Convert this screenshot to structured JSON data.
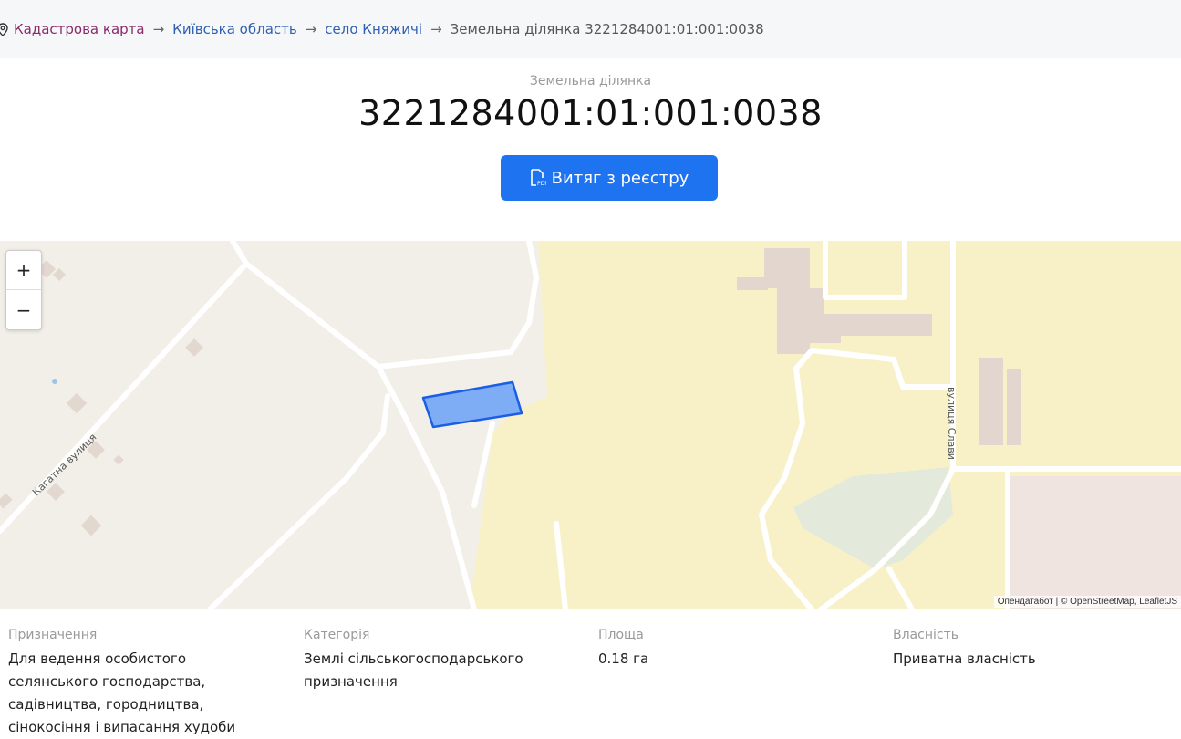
{
  "breadcrumb": {
    "root": "Кадастрова карта",
    "separator": "→",
    "items": [
      "Київська область",
      "село Княжичі"
    ],
    "current": "Земельна ділянка 3221284001:01:001:0038"
  },
  "parcel": {
    "kind_label": "Земельна ділянка",
    "cadastral_number": "3221284001:01:001:0038",
    "extract_button": "Витяг з реєстру"
  },
  "map": {
    "zoom_in": "+",
    "zoom_out": "−",
    "street_labels": [
      "Кагатна вулиця",
      "вулиця Слави"
    ],
    "attribution": "Опендатабот | © OpenStreetMap, LeafletJS",
    "colors": {
      "background": "#f2efe9",
      "residential_yellow": "#f8f1c8",
      "parcel_fill": "#7fadf5",
      "parcel_stroke": "#1a5ee6"
    }
  },
  "info": {
    "purpose": {
      "label": "Призначення",
      "value": "Для ведення особистого селянського господарства, садівництва, городництва, сінокосіння і випасання худоби"
    },
    "category": {
      "label": "Категорія",
      "value": "Землі сільськогосподарського призначення"
    },
    "area": {
      "label": "Площа",
      "value": "0.18 га"
    },
    "ownership": {
      "label": "Власність",
      "value": "Приватна власність"
    }
  }
}
